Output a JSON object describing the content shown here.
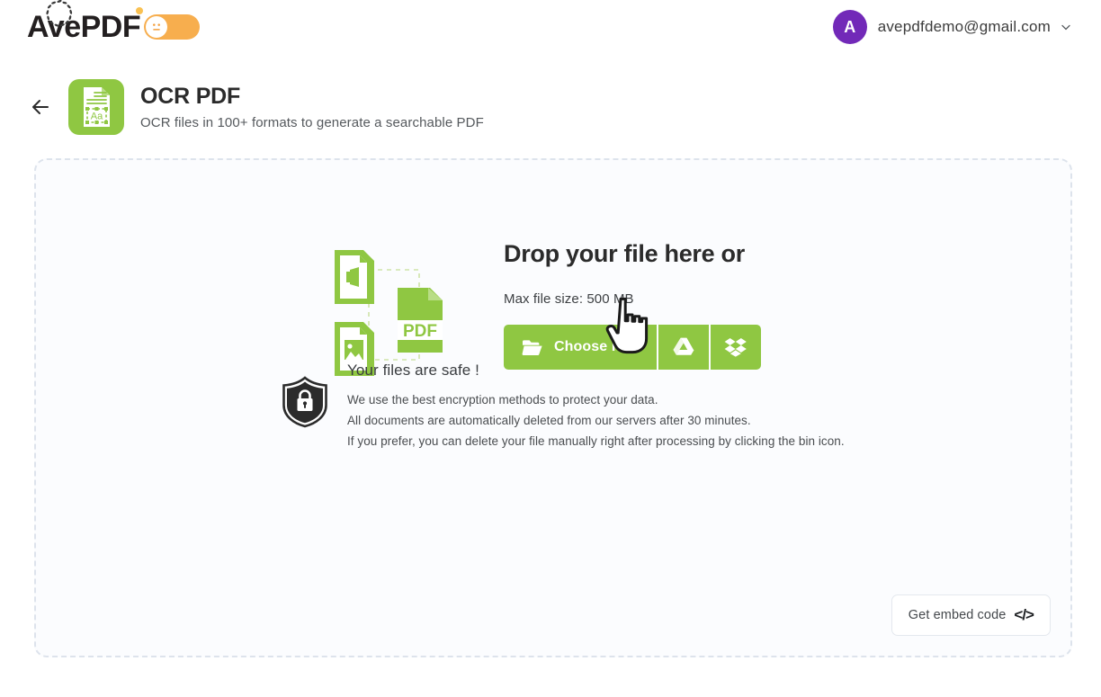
{
  "header": {
    "logo_text": "AvePDF",
    "logo_icon": "laurel-wreath-icon",
    "mood_toggle": {
      "icon": "neutral-face-icon",
      "state": "on",
      "color": "#f7ae4e"
    },
    "user": {
      "avatar_initial": "A",
      "avatar_color": "#7229b8",
      "email": "avepdfdemo@gmail.com",
      "caret_icon": "chevron-down-icon"
    }
  },
  "page": {
    "back_icon": "arrow-left-icon",
    "tool_icon": "ocr-document-icon",
    "tool_icon_color": "#8fc742",
    "title": "OCR PDF",
    "subtitle": "OCR files in 100+ formats to generate a searchable PDF"
  },
  "dropzone": {
    "illustration_icon": "office-image-to-pdf-icon",
    "illustration_label": "PDF",
    "heading": "Drop your file here or",
    "max_size": "Max file size: 500 MB",
    "choose_file": {
      "folder_icon": "folder-open-icon",
      "label": "Choose File",
      "google_drive_icon": "google-drive-icon",
      "dropbox_icon": "dropbox-icon",
      "color": "#8fc742"
    },
    "cursor_icon": "pointing-hand-cursor"
  },
  "safety": {
    "shield_icon": "shield-lock-icon",
    "title": "Your files are safe !",
    "lines": [
      "We use the best encryption methods to protect your data.",
      "All documents are automatically deleted from our servers after 30 minutes.",
      "If you prefer, you can delete your file manually right after processing by clicking the bin icon."
    ]
  },
  "embed": {
    "label": "Get embed code",
    "icon": "code-brackets-icon",
    "icon_glyph": "</>"
  }
}
